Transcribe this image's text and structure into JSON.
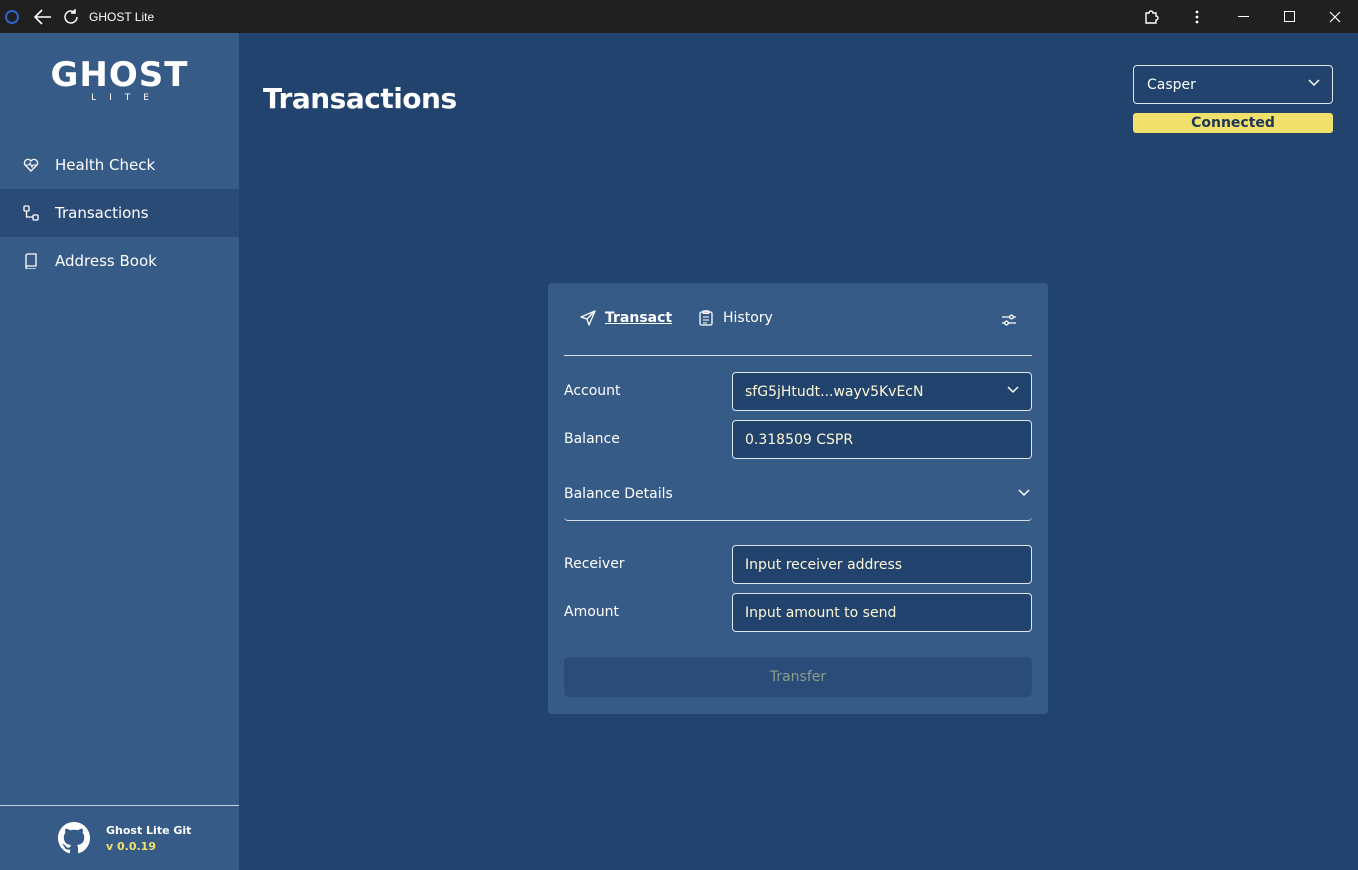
{
  "window": {
    "title": "GHOST Lite"
  },
  "sidebar": {
    "logo_main": "GHOST",
    "logo_sub": "LITE",
    "items": [
      {
        "label": "Health Check",
        "icon": "heart-pulse-icon"
      },
      {
        "label": "Transactions",
        "icon": "transactions-icon",
        "active": true
      },
      {
        "label": "Address Book",
        "icon": "book-icon"
      }
    ],
    "footer": {
      "name": "Ghost Lite Git",
      "version": "v 0.0.19",
      "icon": "github-icon"
    }
  },
  "header": {
    "title": "Transactions",
    "network": "Casper",
    "status": "Connected"
  },
  "card": {
    "tabs": [
      {
        "label": "Transact",
        "icon": "send-icon",
        "active": true
      },
      {
        "label": "History",
        "icon": "clipboard-icon"
      }
    ],
    "account_label": "Account",
    "account_value": "sfG5jHtudt...wayv5KvEcN",
    "balance_label": "Balance",
    "balance_value": "0.318509 CSPR",
    "details_label": "Balance Details",
    "receiver_label": "Receiver",
    "receiver_placeholder": "Input receiver address",
    "amount_label": "Amount",
    "amount_placeholder": "Input amount to send",
    "transfer_label": "Transfer"
  },
  "colors": {
    "background": "#21436e",
    "sidebar": "#375b87",
    "accent": "#f2e06d",
    "titlebar": "#202020"
  }
}
